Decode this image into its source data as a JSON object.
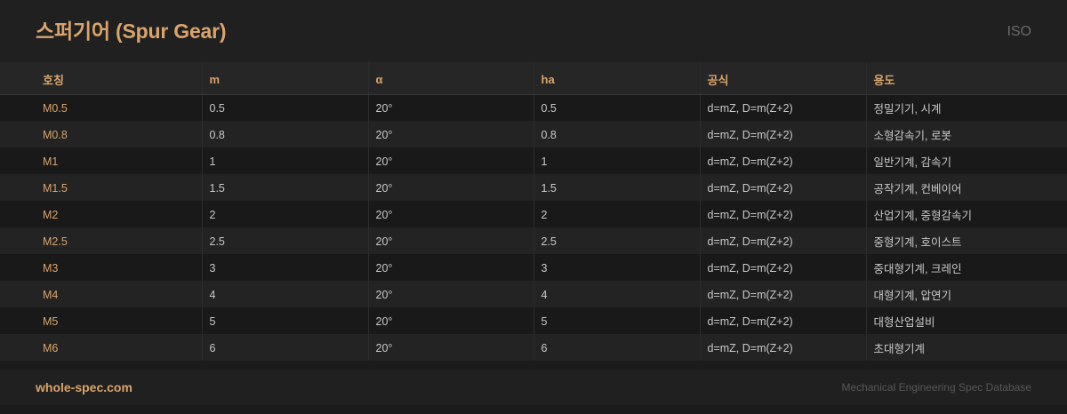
{
  "header": {
    "title": "스퍼기어 (Spur Gear)",
    "standard": "ISO"
  },
  "table": {
    "columns": [
      "호칭",
      "m",
      "α",
      "ha",
      "공식",
      "용도"
    ],
    "rows": [
      [
        "M0.5",
        "0.5",
        "20°",
        "0.5",
        "d=mZ, D=m(Z+2)",
        "정밀기기, 시계"
      ],
      [
        "M0.8",
        "0.8",
        "20°",
        "0.8",
        "d=mZ, D=m(Z+2)",
        "소형감속기, 로봇"
      ],
      [
        "M1",
        "1",
        "20°",
        "1",
        "d=mZ, D=m(Z+2)",
        "일반기계, 감속기"
      ],
      [
        "M1.5",
        "1.5",
        "20°",
        "1.5",
        "d=mZ, D=m(Z+2)",
        "공작기계, 컨베이어"
      ],
      [
        "M2",
        "2",
        "20°",
        "2",
        "d=mZ, D=m(Z+2)",
        "산업기계, 중형감속기"
      ],
      [
        "M2.5",
        "2.5",
        "20°",
        "2.5",
        "d=mZ, D=m(Z+2)",
        "중형기계, 호이스트"
      ],
      [
        "M3",
        "3",
        "20°",
        "3",
        "d=mZ, D=m(Z+2)",
        "중대형기계, 크레인"
      ],
      [
        "M4",
        "4",
        "20°",
        "4",
        "d=mZ, D=m(Z+2)",
        "대형기계, 압연기"
      ],
      [
        "M5",
        "5",
        "20°",
        "5",
        "d=mZ, D=m(Z+2)",
        "대형산업설비"
      ],
      [
        "M6",
        "6",
        "20°",
        "6",
        "d=mZ, D=m(Z+2)",
        "초대형기계"
      ]
    ]
  },
  "footer": {
    "brand": "whole-spec.com",
    "tagline": "Mechanical Engineering Spec Database"
  },
  "colors": {
    "accent": "#d9a46b",
    "background": "#1b1b1b",
    "header_bg": "#202020",
    "row_odd": "#191919",
    "row_even": "#232323",
    "text": "#c9c9c9",
    "muted": "#6a6a6a"
  }
}
